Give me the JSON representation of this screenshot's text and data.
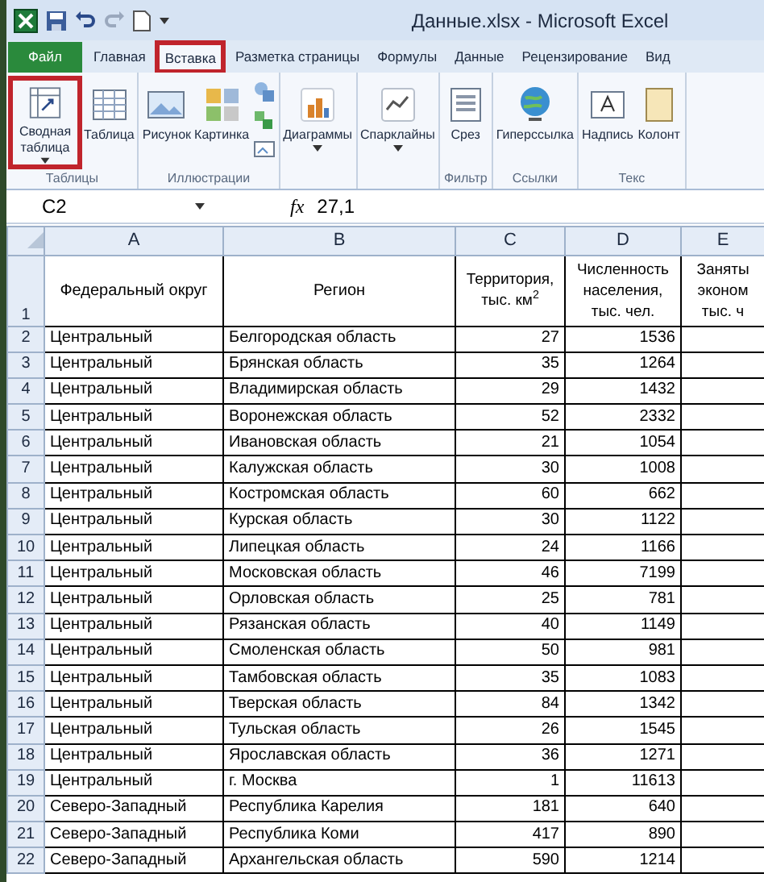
{
  "window": {
    "title": "Данные.xlsx - Microsoft Excel"
  },
  "tabs": [
    {
      "label": "Файл",
      "kind": "file",
      "selected": false,
      "highlighted": false
    },
    {
      "label": "Главная",
      "kind": "tab",
      "selected": false,
      "highlighted": false
    },
    {
      "label": "Вставка",
      "kind": "tab",
      "selected": true,
      "highlighted": true
    },
    {
      "label": "Разметка страницы",
      "kind": "tab",
      "selected": false,
      "highlighted": false
    },
    {
      "label": "Формулы",
      "kind": "tab",
      "selected": false,
      "highlighted": false
    },
    {
      "label": "Данные",
      "kind": "tab",
      "selected": false,
      "highlighted": false
    },
    {
      "label": "Рецензирование",
      "kind": "tab",
      "selected": false,
      "highlighted": false
    },
    {
      "label": "Вид",
      "kind": "tab",
      "selected": false,
      "highlighted": false
    }
  ],
  "ribbon": {
    "groups": [
      {
        "label": "Таблицы",
        "buttons": [
          {
            "label": "Сводная таблица",
            "dropdown": true,
            "highlighted": true
          },
          {
            "label": "Таблица",
            "dropdown": false,
            "highlighted": false
          }
        ]
      },
      {
        "label": "Иллюстрации",
        "buttons": [
          {
            "label": "Рисунок",
            "dropdown": false,
            "highlighted": false
          },
          {
            "label": "Картинка",
            "dropdown": false,
            "highlighted": false
          }
        ]
      },
      {
        "buttons": [
          {
            "label": "Диаграммы",
            "dropdown": true,
            "highlighted": false
          }
        ]
      },
      {
        "buttons": [
          {
            "label": "Спарклайны",
            "dropdown": true,
            "highlighted": false
          }
        ]
      },
      {
        "label": "Фильтр",
        "buttons": [
          {
            "label": "Срез",
            "dropdown": false,
            "highlighted": false
          }
        ]
      },
      {
        "label": "Ссылки",
        "buttons": [
          {
            "label": "Гиперссылка",
            "dropdown": false,
            "highlighted": false
          }
        ]
      },
      {
        "label": "Текс",
        "buttons": [
          {
            "label": "Надпись",
            "dropdown": false,
            "highlighted": false
          },
          {
            "label": "Колонт",
            "dropdown": false,
            "highlighted": false
          }
        ]
      }
    ]
  },
  "formula_bar": {
    "name_box": "C2",
    "fx": "fx",
    "value": "27,1"
  },
  "sheet": {
    "columns": [
      "A",
      "B",
      "C",
      "D",
      "E"
    ],
    "header_row": {
      "number": "1",
      "cells": [
        "Федеральный округ",
        "Регион",
        "Территория, тыс. км$^{2}$",
        "Численность населения, тыс. чел.",
        "Заняты эконом тыс. ч"
      ]
    },
    "rows": [
      {
        "number": "2",
        "cells": [
          "Центральный",
          "Белгородская область",
          "27",
          "1536"
        ]
      },
      {
        "number": "3",
        "cells": [
          "Центральный",
          "Брянская область",
          "35",
          "1264"
        ]
      },
      {
        "number": "4",
        "cells": [
          "Центральный",
          "Владимирская область",
          "29",
          "1432"
        ]
      },
      {
        "number": "5",
        "cells": [
          "Центральный",
          "Воронежская область",
          "52",
          "2332"
        ]
      },
      {
        "number": "6",
        "cells": [
          "Центральный",
          "Ивановская область",
          "21",
          "1054"
        ]
      },
      {
        "number": "7",
        "cells": [
          "Центральный",
          "Калужская область",
          "30",
          "1008"
        ]
      },
      {
        "number": "8",
        "cells": [
          "Центральный",
          "Костромская область",
          "60",
          "662"
        ]
      },
      {
        "number": "9",
        "cells": [
          "Центральный",
          "Курская область",
          "30",
          "1122"
        ]
      },
      {
        "number": "10",
        "cells": [
          "Центральный",
          "Липецкая область",
          "24",
          "1166"
        ]
      },
      {
        "number": "11",
        "cells": [
          "Центральный",
          "Московская область",
          "46",
          "7199"
        ]
      },
      {
        "number": "12",
        "cells": [
          "Центральный",
          "Орловская область",
          "25",
          "781"
        ]
      },
      {
        "number": "13",
        "cells": [
          "Центральный",
          "Рязанская область",
          "40",
          "1149"
        ]
      },
      {
        "number": "14",
        "cells": [
          "Центральный",
          "Смоленская область",
          "50",
          "981"
        ]
      },
      {
        "number": "15",
        "cells": [
          "Центральный",
          "Тамбовская область",
          "35",
          "1083"
        ]
      },
      {
        "number": "16",
        "cells": [
          "Центральный",
          "Тверская область",
          "84",
          "1342"
        ]
      },
      {
        "number": "17",
        "cells": [
          "Центральный",
          "Тульская область",
          "26",
          "1545"
        ]
      },
      {
        "number": "18",
        "cells": [
          "Центральный",
          "Ярославская область",
          "36",
          "1271"
        ]
      },
      {
        "number": "19",
        "cells": [
          "Центральный",
          "г. Москва",
          "1",
          "11613"
        ]
      },
      {
        "number": "20",
        "cells": [
          "Северо-Западный",
          "Республика Карелия",
          "181",
          "640"
        ]
      },
      {
        "number": "21",
        "cells": [
          "Северо-Западный",
          "Республика Коми",
          "417",
          "890"
        ]
      },
      {
        "number": "22",
        "cells": [
          "Северо-Западный",
          "Архангельская область",
          "590",
          "1214"
        ]
      }
    ]
  }
}
